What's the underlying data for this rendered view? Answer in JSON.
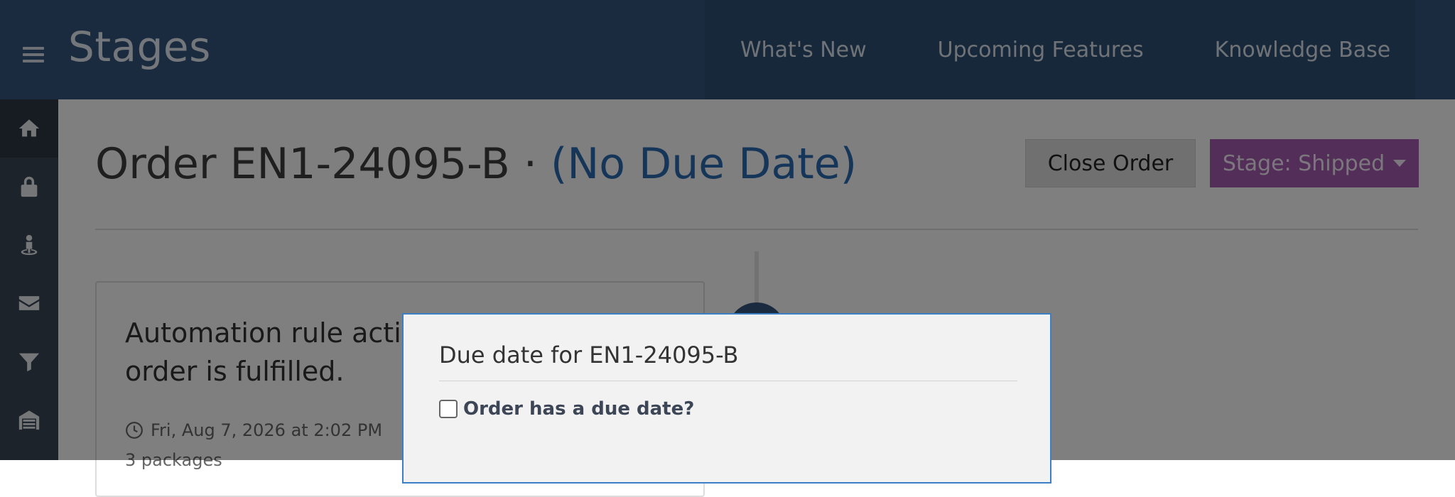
{
  "header": {
    "brand": "Stages",
    "nav": [
      "What's New",
      "Upcoming Features",
      "Knowledge Base"
    ]
  },
  "sidebar": {
    "icons": [
      "home-icon",
      "lock-icon",
      "user-location-icon",
      "envelope-icon",
      "filter-icon",
      "warehouse-icon"
    ]
  },
  "page": {
    "title": "Order EN1-24095-B · ",
    "due": "(No Due Date)",
    "close_button": "Close Order",
    "stage_button": "Stage: Shipped"
  },
  "card": {
    "text": "Automation rule activ order is fulfilled.",
    "line1": "Automation rule activ",
    "line2": "order is fulfilled.",
    "timestamp": "Fri, Aug 7, 2026 at 2:02 PM",
    "sub": "3 packages"
  },
  "modal": {
    "title": "Due date for EN1-24095-B",
    "checkbox_label": "Order has a due date?"
  },
  "colors": {
    "header": "#34577e",
    "sidebar": "#3a4656",
    "stage": "#a45db3",
    "link": "#2b6cb0"
  }
}
